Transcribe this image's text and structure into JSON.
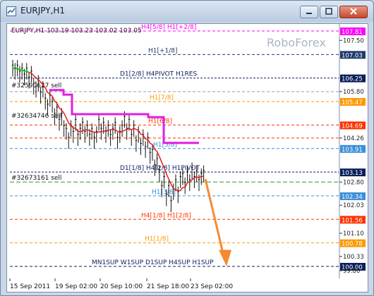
{
  "window": {
    "title": "EURJPY,H1",
    "icon_name": "chart-window-icon",
    "buttons": [
      "minimize-icon",
      "maximize-icon",
      "close-icon"
    ]
  },
  "chart": {
    "symbol_info": "EURJPY,H1  103.19 103.23 103.02 103.05",
    "watermark": "RoboForex",
    "arrow_color": "#f58a32"
  },
  "levels": [
    {
      "label": "H4[5/8] H1[+2/8]",
      "price": "107.81",
      "color": "#ff00ff"
    },
    {
      "label": "",
      "price": "107.50",
      "color": ""
    },
    {
      "label": "H1[+1/8]",
      "price": "107.03",
      "color": "#1f3a6b"
    },
    {
      "label": "D1[2/8] H4PIVOT H1RES",
      "price": "106.25",
      "color": "#0b1f5c"
    },
    {
      "label": "",
      "price": "105.80",
      "color": ""
    },
    {
      "label": "H1[7/8]",
      "price": "105.47",
      "color": "#ff9900"
    },
    {
      "label": "H1[6/8]",
      "price": "104.69",
      "color": "#ff3300"
    },
    {
      "label": "",
      "price": "104.26",
      "color": ""
    },
    {
      "label": "H1[5/8]",
      "price": "103.91",
      "color": "#3a8fd9"
    },
    {
      "label": "D1[1/8] H4[2/8] H1PIVOT",
      "price": "103.13",
      "color": "#0b1f5c"
    },
    {
      "label": "",
      "price": "102.80",
      "color": ""
    },
    {
      "label": "H1[3/8]",
      "price": "102.34",
      "color": "#3a8fd9"
    },
    {
      "label": "",
      "price": "102.03",
      "color": ""
    },
    {
      "label": "H4[1/8] H1[2/8]",
      "price": "101.56",
      "color": "#ff3300"
    },
    {
      "label": "",
      "price": "101.10",
      "color": ""
    },
    {
      "label": "H1[1/8]",
      "price": "100.78",
      "color": "#ff9900"
    },
    {
      "label": "",
      "price": "100.33",
      "color": ""
    },
    {
      "label": "MN1SUP W1SUP D1SUP H4SUP H1SUP",
      "price": "100.00",
      "color": "#0b1f5c"
    },
    {
      "label": "",
      "price": "99.86",
      "color": ""
    }
  ],
  "orders": [
    {
      "label": "#32590627 sell"
    },
    {
      "label": "#32634746 sell"
    },
    {
      "label": "#32673161 sell"
    }
  ],
  "time_axis": [
    "15 Sep 2011",
    "19 Sep 02:00",
    "20 Sep 10:00",
    "21 Sep 18:00",
    "23 Sep 02:00"
  ],
  "price_tags": {
    "current": "103.13"
  }
}
